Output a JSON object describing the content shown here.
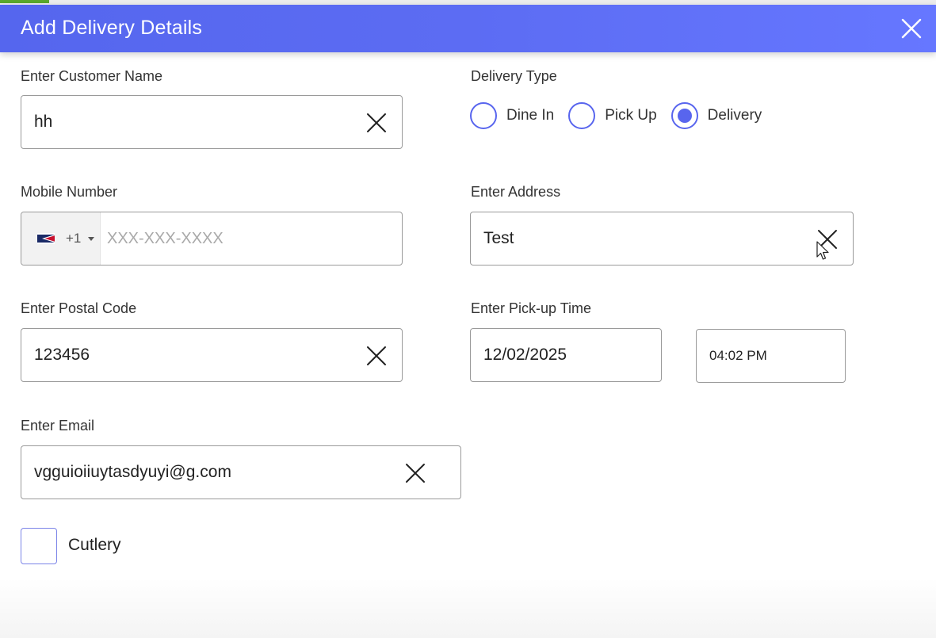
{
  "dialog": {
    "title": "Add Delivery Details"
  },
  "form": {
    "customer_name": {
      "label": "Enter Customer Name",
      "value": "hh"
    },
    "delivery_type": {
      "label": "Delivery Type",
      "options": [
        {
          "label": "Dine In",
          "selected": false
        },
        {
          "label": "Pick Up",
          "selected": false
        },
        {
          "label": "Delivery",
          "selected": true
        }
      ]
    },
    "mobile": {
      "label": "Mobile Number",
      "dial_code": "+1",
      "placeholder": "XXX-XXX-XXXX",
      "value": ""
    },
    "address": {
      "label": "Enter Address",
      "value": "Test"
    },
    "postal_code": {
      "label": "Enter Postal Code",
      "value": "123456"
    },
    "pickup_time": {
      "label": "Enter Pick-up Time",
      "date": "12/02/2025",
      "time": "04:02 PM"
    },
    "email": {
      "label": "Enter Email",
      "value": "vgguioiiuytasdyuyi@g.com"
    },
    "cutlery": {
      "label": "Cutlery",
      "checked": false
    }
  },
  "icons": {
    "close": "close-icon",
    "clear": "clear-icon",
    "flag": "flag-icon",
    "cursor": "mouse-cursor-icon"
  },
  "colors": {
    "header_start": "#5566ee",
    "header_end": "#6677ff",
    "accent": "#5865ee",
    "border": "#9a9a9a"
  }
}
